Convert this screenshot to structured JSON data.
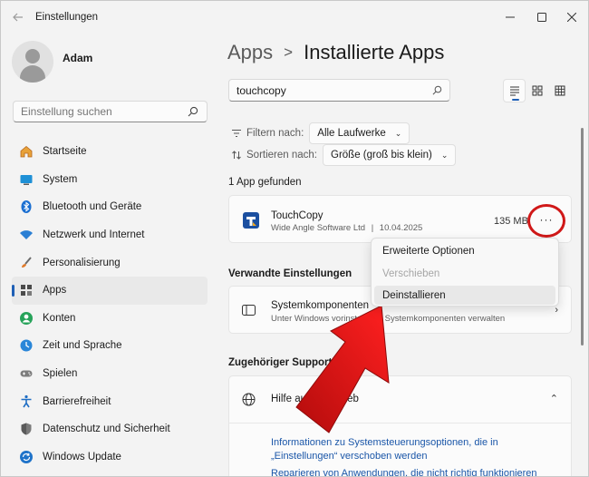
{
  "window": {
    "title": "Einstellungen"
  },
  "profile": {
    "name": "Adam"
  },
  "sidebar": {
    "search_placeholder": "Einstellung suchen",
    "items": [
      {
        "label": "Startseite",
        "icon": "home-icon"
      },
      {
        "label": "System",
        "icon": "monitor-icon"
      },
      {
        "label": "Bluetooth und Geräte",
        "icon": "bluetooth-icon"
      },
      {
        "label": "Netzwerk und Internet",
        "icon": "wifi-icon"
      },
      {
        "label": "Personalisierung",
        "icon": "brush-icon"
      },
      {
        "label": "Apps",
        "icon": "apps-icon",
        "active": true
      },
      {
        "label": "Konten",
        "icon": "account-icon"
      },
      {
        "label": "Zeit und Sprache",
        "icon": "clock-globe-icon"
      },
      {
        "label": "Spielen",
        "icon": "gamepad-icon"
      },
      {
        "label": "Barrierefreiheit",
        "icon": "accessibility-icon"
      },
      {
        "label": "Datenschutz und Sicherheit",
        "icon": "shield-icon"
      },
      {
        "label": "Windows Update",
        "icon": "update-icon"
      }
    ]
  },
  "breadcrumb": {
    "parent": "Apps",
    "separator": ">",
    "current": "Installierte Apps"
  },
  "app_search": {
    "value": "touchcopy"
  },
  "filter": {
    "label": "Filtern nach:",
    "value": "Alle Laufwerke"
  },
  "sort": {
    "label": "Sortieren nach:",
    "value": "Größe (groß bis klein)"
  },
  "results": {
    "count_text": "1 App gefunden"
  },
  "app": {
    "name": "TouchCopy",
    "publisher": "Wide Angle Software Ltd",
    "separator": "|",
    "date": "10.04.2025",
    "size": "135 MB",
    "more_label": "···"
  },
  "context_menu": {
    "items": [
      {
        "label": "Erweiterte Optionen",
        "enabled": true
      },
      {
        "label": "Verschieben",
        "enabled": false
      },
      {
        "label": "Deinstallieren",
        "enabled": true,
        "highlighted": true
      }
    ]
  },
  "related": {
    "title": "Verwandte Einstellungen",
    "card_title": "Systemkomponenten",
    "card_subtitle": "Unter Windows vorinstallierte Systemkomponenten verwalten"
  },
  "support": {
    "title": "Zugehöriger Support",
    "card_title": "Hilfe aus dem Web",
    "link1": "Informationen zu Systemsteuerungsoptionen, die in „Einstellungen“ verschoben werden",
    "link2": "Reparieren von Anwendungen, die nicht richtig funktionieren"
  },
  "colors": {
    "accent": "#1e5fb5",
    "highlight_red": "#d01818",
    "link": "#1a56a8"
  }
}
